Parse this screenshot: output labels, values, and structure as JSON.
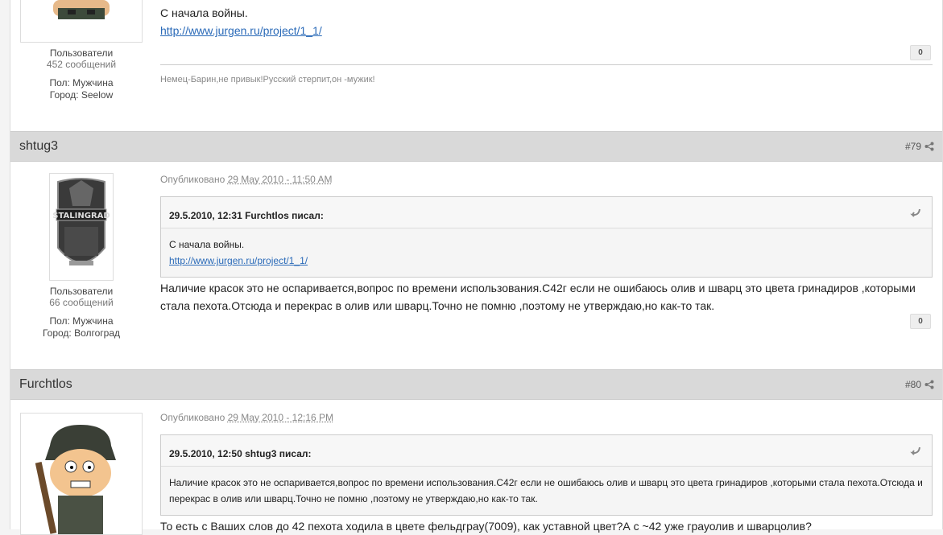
{
  "post78": {
    "body_line1": "С начала войны.",
    "link": "http://www.jurgen.ru/project/1_1/",
    "reputation": "0",
    "signature": "Немец-Барин,не привык!Русский стерпит,он -мужик!",
    "author": {
      "group": "Пользователи",
      "count": "452 сообщений",
      "gender": "Пол: Мужчина",
      "city": "Город: Seelow"
    }
  },
  "post79": {
    "author_name": "shtug3",
    "post_number": "#79",
    "published_label": "Опубликовано",
    "published_date": "29 May 2010 - 11:50 AM",
    "author": {
      "group": "Пользователи",
      "count": "66 сообщений",
      "gender": "Пол: Мужчина",
      "city": "Город: Волгоград"
    },
    "quote": {
      "title": "29.5.2010, 12:31 Furchtlos писал:",
      "line1": "С начала войны.",
      "link": "http://www.jurgen.ru/project/1_1/"
    },
    "body": "Наличие красок это не оспаривается,вопрос по времени использования.С42г если не ошибаюсь олив и шварц это цвета гринадиров ,которыми стала пехота.Отсюда и перекрас в олив или шварц.Точно не помню ,поэтому не утверждаю,но как-то так.",
    "reputation": "0",
    "avatar_text": "STALINGRAD"
  },
  "post80": {
    "author_name": "Furchtlos",
    "post_number": "#80",
    "published_label": "Опубликовано",
    "published_date": "29 May 2010 - 12:16 PM",
    "quote": {
      "title": "29.5.2010, 12:50 shtug3 писал:",
      "text": "Наличие красок это не оспаривается,вопрос по времени использования.С42г если не ошибаюсь олив и шварц это цвета гринадиров ,которыми стала пехота.Отсюда и перекрас в олив или шварц.Точно не помню ,поэтому не утверждаю,но как-то так."
    },
    "body": "То есть с Ваших слов до 42 пехота ходила в цвете фельдграу(7009), как уставной цвет?А с ~42 уже грауолив и шварцолив?"
  },
  "colors": {
    "header_bg": "#d9d9d9",
    "link": "#2a6ab8",
    "quote_bg": "#f5f5f5"
  }
}
